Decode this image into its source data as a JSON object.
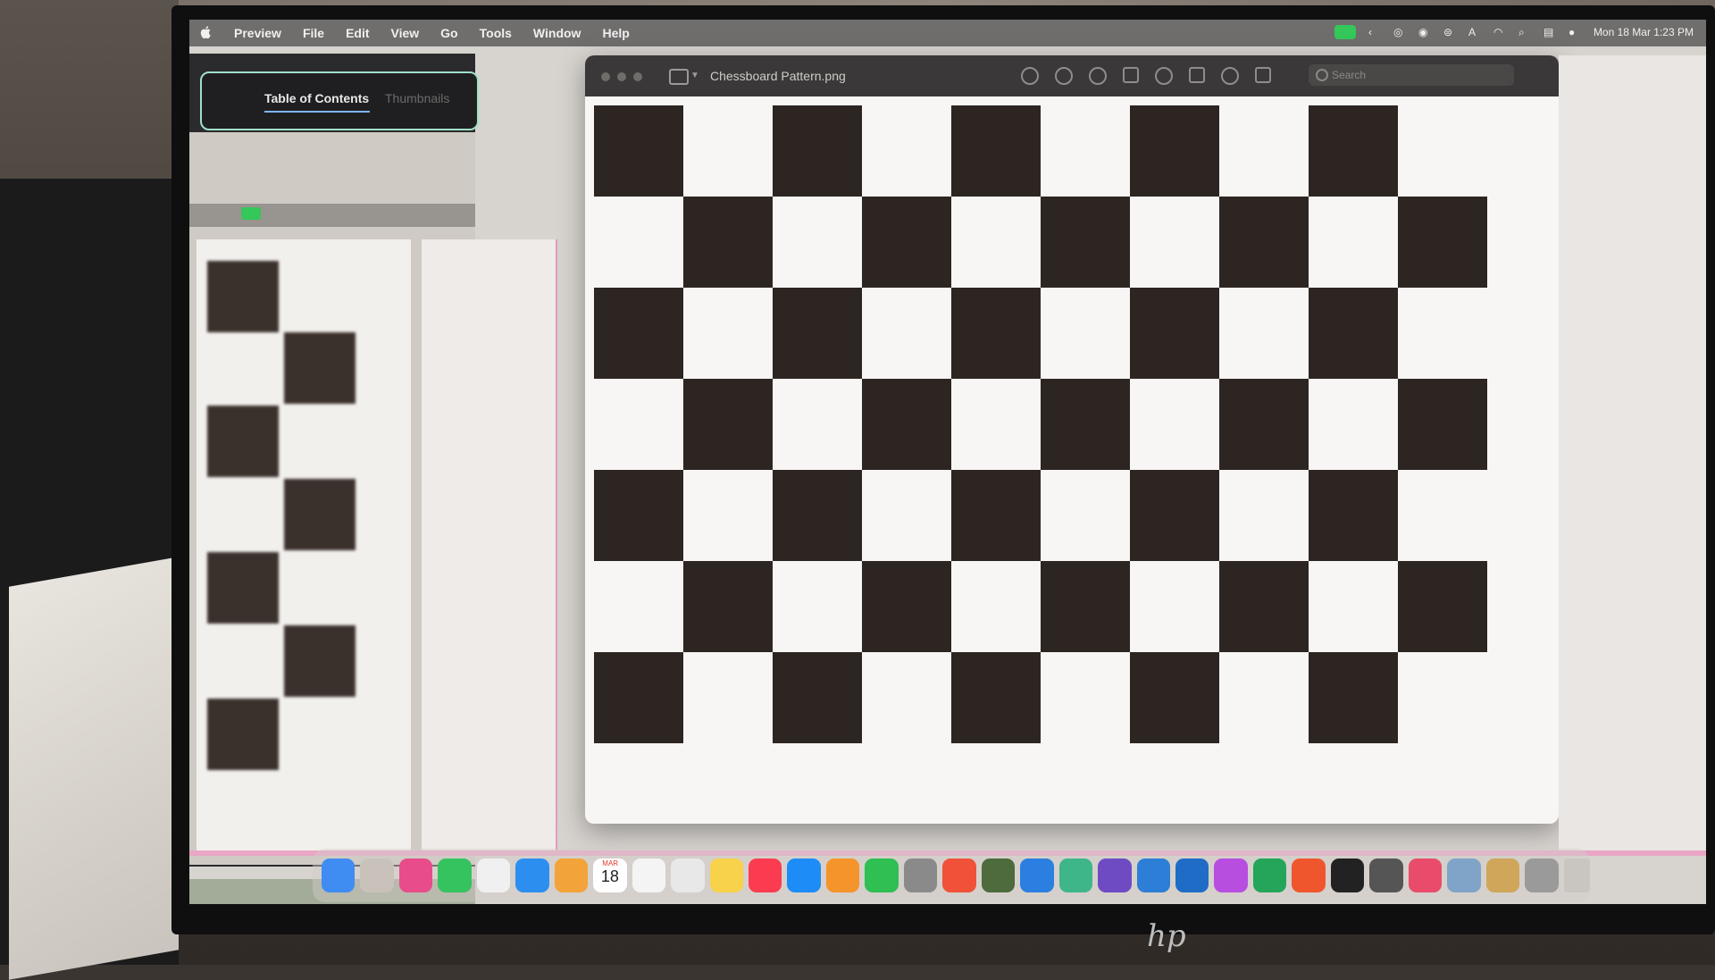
{
  "menubar": {
    "app_name": "Preview",
    "items": [
      "File",
      "Edit",
      "View",
      "Go",
      "Tools",
      "Window",
      "Help"
    ],
    "datetime": "Mon 18 Mar 1:23 PM"
  },
  "sidebar": {
    "tab_active": "Table of Contents",
    "tab_inactive": "Thumbnails"
  },
  "window": {
    "title": "Chessboard Pattern.png",
    "search_placeholder": "Search"
  },
  "board": {
    "columns": 10,
    "rows": 7,
    "dark_color": "#2d2522",
    "light_color": "#f7f6f4"
  },
  "dock": {
    "calendar_month": "MAR",
    "calendar_day": "18",
    "apps": [
      {
        "name": "finder",
        "color": "#3f8cf2"
      },
      {
        "name": "launchpad",
        "color": "#c8c2ba"
      },
      {
        "name": "app-store-star",
        "color": "#e84c8a"
      },
      {
        "name": "whatsapp",
        "color": "#35c35f"
      },
      {
        "name": "freeform",
        "color": "#f0f0f0"
      },
      {
        "name": "safari",
        "color": "#2c8ff0"
      },
      {
        "name": "photos",
        "color": "#f2a33a"
      },
      {
        "name": "calendar",
        "color": "#ffffff"
      },
      {
        "name": "reminders",
        "color": "#f4f4f4"
      },
      {
        "name": "textedit",
        "color": "#e8e8e8"
      },
      {
        "name": "notes",
        "color": "#f7d24a"
      },
      {
        "name": "music",
        "color": "#fb3c50"
      },
      {
        "name": "app-store",
        "color": "#1d8cf6"
      },
      {
        "name": "pages",
        "color": "#f4942b"
      },
      {
        "name": "numbers",
        "color": "#2fbf52"
      },
      {
        "name": "system-settings",
        "color": "#8a8a8a"
      },
      {
        "name": "swift",
        "color": "#f05138"
      },
      {
        "name": "game",
        "color": "#4d6b3c"
      },
      {
        "name": "xcode",
        "color": "#2b7fe0"
      },
      {
        "name": "maps",
        "color": "#3fb68a"
      },
      {
        "name": "github",
        "color": "#6e4bc3"
      },
      {
        "name": "vscode",
        "color": "#2d7ed6"
      },
      {
        "name": "outlook",
        "color": "#1f6cc6"
      },
      {
        "name": "shortcuts",
        "color": "#b84ee0"
      },
      {
        "name": "sheets",
        "color": "#24a55a"
      },
      {
        "name": "figma",
        "color": "#f0562e"
      },
      {
        "name": "terminal",
        "color": "#222222"
      },
      {
        "name": "utility",
        "color": "#555555"
      },
      {
        "name": "preview",
        "color": "#e84c6a"
      },
      {
        "name": "screenshot",
        "color": "#7fa4c8"
      },
      {
        "name": "pencil",
        "color": "#cfa65a"
      },
      {
        "name": "downloads",
        "color": "#9a9a9a"
      }
    ]
  }
}
